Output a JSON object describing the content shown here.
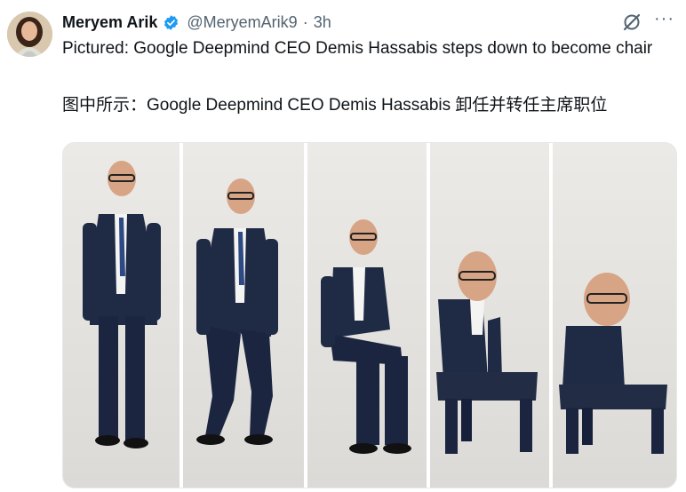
{
  "author": {
    "name": "Meryem Arik",
    "handle": "@MeryemArik9",
    "separator": "·",
    "time": "3h",
    "verified_color": "#1d9bf0"
  },
  "tweet": {
    "text_en": "Pictured: Google Deepmind CEO Demis Hassabis steps down to become chair",
    "text_zh": "图中所示：Google Deepmind CEO Demis Hassabis 卸任并转任主席职位"
  },
  "icons": {
    "grok": "grok-icon",
    "more": "more-icon",
    "verified": "verified-badge-icon"
  },
  "colors": {
    "text": "#0f1419",
    "secondary": "#536471",
    "suit": "#1f2a44",
    "backdrop": "#e7e6e3"
  },
  "more_label": "···"
}
